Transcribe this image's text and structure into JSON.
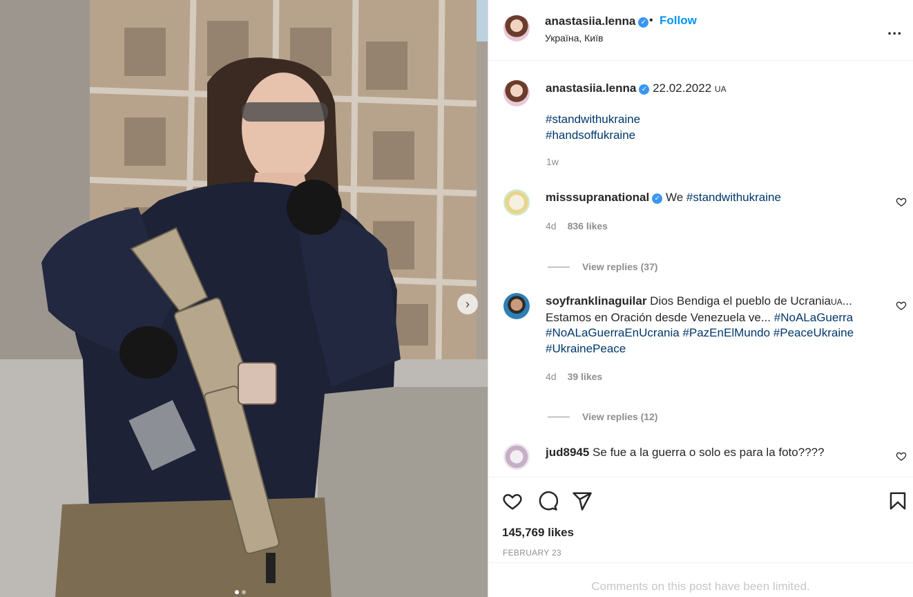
{
  "post": {
    "username": "anastasiia.lenna",
    "verified": true,
    "separator": "•",
    "follow_label": "Follow",
    "location": "Україна, Київ",
    "more_label": "..."
  },
  "caption": {
    "username": "anastasiia.lenna",
    "date_text": "22.02.2022",
    "flag_text": "UA",
    "hashtags": [
      "#standwithukraine",
      "#handsoffukraine"
    ],
    "age": "1w"
  },
  "comments": [
    {
      "username": "misssupranational",
      "verified": true,
      "text": "We",
      "hashtag": "#standwithukraine",
      "age": "4d",
      "likes": "836 likes",
      "replies": "View replies (37)"
    },
    {
      "username": "soyfranklinaguilar",
      "text_line1": "Dios Bendiga el pueblo de Ucrania",
      "text_ua": "UA",
      "text_ellipsis": "...",
      "text_line2": "Estamos en Oración desde Venezuela ve...",
      "hashtags_line2": "#NoALaGuerra",
      "hashtags_line3": "#NoALaGuerraEnUcrania #PazEnElMundo #PeaceUkraine",
      "hashtags_line4": "#UkrainePeace",
      "age": "4d",
      "likes": "39 likes",
      "replies": "View replies (12)"
    },
    {
      "username": "jud8945",
      "text": "Se fue a la guerra o solo es para la foto????"
    }
  ],
  "actions": {
    "icons": [
      "heart-icon",
      "comment-icon",
      "share-icon",
      "bookmark-icon"
    ],
    "likes_count": "145,769 likes",
    "post_date": "FEBRUARY 23",
    "comments_limited": "Comments on this post have been limited."
  },
  "carousel": {
    "current": 1,
    "total": 2
  },
  "colors": {
    "link": "#00376b",
    "follow": "#0095f6",
    "verified": "#3897f0",
    "muted": "#8e8e8e"
  }
}
